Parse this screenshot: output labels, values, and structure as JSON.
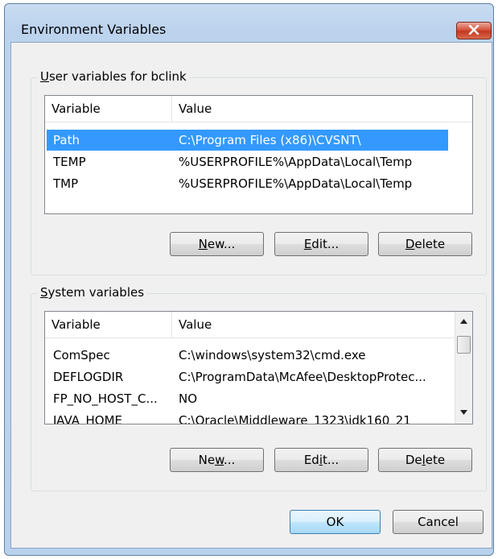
{
  "window": {
    "title": "Environment Variables"
  },
  "user_group": {
    "label_prefix": "",
    "label_accel": "U",
    "label_rest": "ser variables for bclink",
    "columns": [
      "Variable",
      "Value"
    ],
    "rows": [
      {
        "variable": "Path",
        "value": "C:\\Program Files (x86)\\CVSNT\\",
        "selected": true
      },
      {
        "variable": "TEMP",
        "value": "%USERPROFILE%\\AppData\\Local\\Temp",
        "selected": false
      },
      {
        "variable": "TMP",
        "value": "%USERPROFILE%\\AppData\\Local\\Temp",
        "selected": false
      }
    ],
    "buttons": {
      "new": {
        "accel": "N",
        "rest": "ew..."
      },
      "edit": {
        "accel": "E",
        "rest": "dit..."
      },
      "delete": {
        "accel": "D",
        "rest": "elete"
      }
    }
  },
  "system_group": {
    "label_accel": "S",
    "label_rest": "ystem variables",
    "columns": [
      "Variable",
      "Value"
    ],
    "rows": [
      {
        "variable": "ComSpec",
        "value": "C:\\windows\\system32\\cmd.exe"
      },
      {
        "variable": "DEFLOGDIR",
        "value": "C:\\ProgramData\\McAfee\\DesktopProtec..."
      },
      {
        "variable": "FP_NO_HOST_C...",
        "value": "NO"
      },
      {
        "variable": "JAVA_HOME",
        "value": "C:\\Oracle\\Middleware_1323\\jdk160_21"
      }
    ],
    "buttons": {
      "new": {
        "pre": "Ne",
        "accel": "w",
        "rest": "..."
      },
      "edit": {
        "pre": "Ed",
        "accel": "i",
        "rest": "t..."
      },
      "delete": {
        "pre": "De",
        "accel": "l",
        "rest": "ete"
      }
    }
  },
  "footer": {
    "ok": "OK",
    "cancel": "Cancel"
  },
  "icons": {
    "close": "close-icon",
    "scroll_up": "scroll-up-arrow-icon",
    "scroll_down": "scroll-down-arrow-icon"
  }
}
